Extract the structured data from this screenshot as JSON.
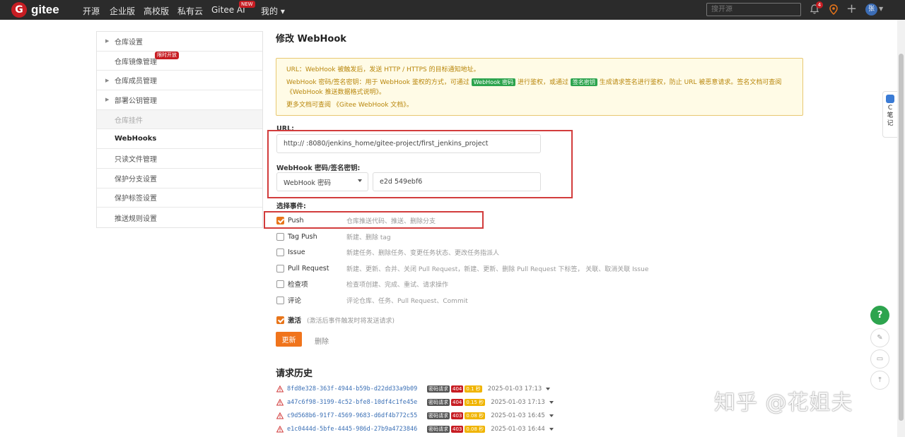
{
  "nav": {
    "logo_mark": "G",
    "logo_text": "gitee",
    "items": [
      "开源",
      "企业版",
      "高校版",
      "私有云",
      "Gitee AI",
      "我的 ▾"
    ],
    "new_badge": "NEW",
    "search_placeholder": "搜开源",
    "bell_count": "4",
    "avatar_text": "张"
  },
  "sidebar": {
    "items": [
      {
        "label": "仓库设置",
        "expandable": true
      },
      {
        "label": "仓库镜像管理",
        "tag": "限时开放"
      },
      {
        "label": "仓库成员管理",
        "expandable": true
      },
      {
        "label": "部署公钥管理",
        "expandable": true
      },
      {
        "label": "仓库挂件",
        "state": "disabled"
      },
      {
        "label": "WebHooks",
        "state": "active"
      },
      {
        "label": "只读文件管理"
      },
      {
        "label": "保护分支设置"
      },
      {
        "label": "保护标签设置"
      },
      {
        "label": "推送规则设置"
      }
    ]
  },
  "main": {
    "title": "修改 WebHook",
    "notice": {
      "line1": "URL：WebHook 被触发后，发送 HTTP / HTTPS 的目标通知地址。",
      "line2_a": "WebHook 密码/签名密钥：用于 WebHook 鉴权的方式，可通过",
      "line2_tag1": "WebHook 密码",
      "line2_b": "进行鉴权，或通过",
      "line2_tag2": "签名密钥",
      "line2_c": "生成请求签名进行鉴权，防止 URL 被恶意请求。签名文档可查阅",
      "line2_link": "《WebHook 推送数据格式说明》",
      "line2_d": "。",
      "line3_a": "更多文档可查阅",
      "line3_link": "《Gitee WebHook 文档》",
      "line3_b": "。"
    },
    "url_label": "URL:",
    "url_value": "http://               :8080/jenkins_home/gitee-project/first_jenkins_project",
    "secret_label": "WebHook 密码/签名密钥:",
    "secret_type": "WebHook 密码",
    "secret_value": "e2d                                    549ebf6",
    "events_label": "选择事件:",
    "events": [
      {
        "name": "Push",
        "desc": "仓库推送代码、推送、删除分支",
        "checked": true
      },
      {
        "name": "Tag Push",
        "desc": "新建、删除 tag",
        "checked": false
      },
      {
        "name": "Issue",
        "desc": "新建任务、删除任务、变更任务状态、更改任务指派人",
        "checked": false
      },
      {
        "name": "Pull Request",
        "desc": "新建、更新、合并、关闭 Pull Request，新建、更新、删除 Pull Request 下标签， 关联、取消关联 Issue",
        "checked": false
      },
      {
        "name": "检查项",
        "desc": "检查项创建、完成、重试、请求操作",
        "checked": false
      },
      {
        "name": "评论",
        "desc": "评论仓库、任务、Pull Request、Commit",
        "checked": false
      }
    ],
    "active_label": "激活",
    "active_desc": "(激活后事件触发时将发送请求)",
    "update_label": "更新",
    "delete_label": "删除",
    "history_title": "请求历史",
    "history": [
      {
        "id": "8fd8e328-363f-4944-b59b-d22dd33a9b09",
        "type": "密码请求",
        "code": "404",
        "time": "0.1 秒",
        "date": "2025-01-03 17:13"
      },
      {
        "id": "a47c6f98-3199-4c52-bfe8-10df4c1fe45e",
        "type": "密码请求",
        "code": "404",
        "time": "0.15 秒",
        "date": "2025-01-03 17:13"
      },
      {
        "id": "c9d568b6-91f7-4569-9683-d6df4b772c55",
        "type": "密码请求",
        "code": "403",
        "time": "0.08 秒",
        "date": "2025-01-03 16:45"
      },
      {
        "id": "e1c0444d-5bfe-4445-986d-27b9a4723846",
        "type": "密码请求",
        "code": "403",
        "time": "0.08 秒",
        "date": "2025-01-03 16:44"
      }
    ]
  },
  "floating": {
    "note_text": "C\n笔\n记",
    "help": "?"
  },
  "watermark": "知乎 @花姐夫"
}
